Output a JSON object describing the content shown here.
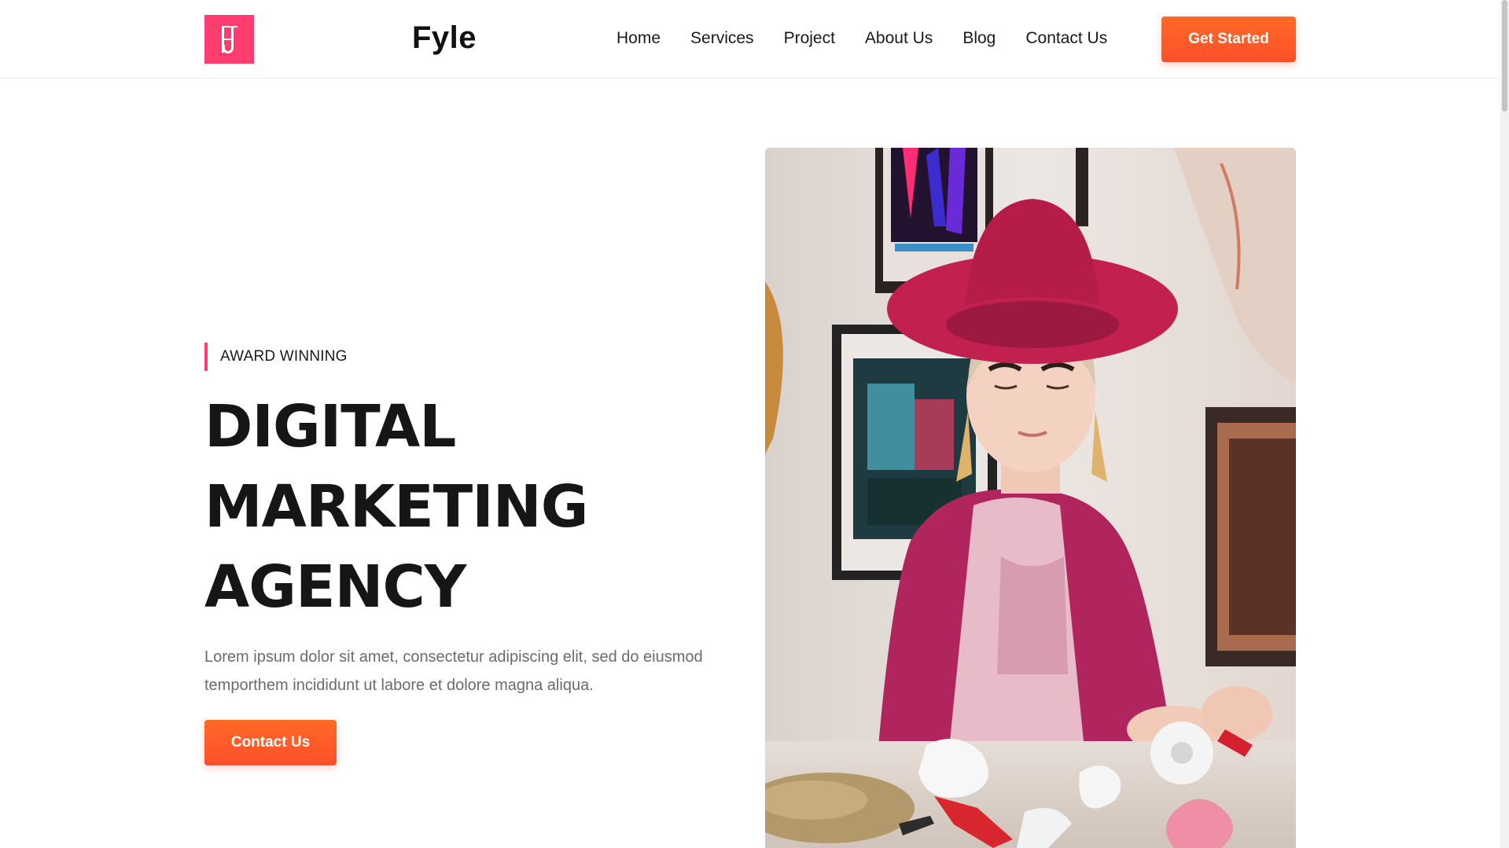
{
  "header": {
    "brand": "Fyle",
    "nav": [
      "Home",
      "Services",
      "Project",
      "About Us",
      "Blog",
      "Contact Us"
    ],
    "cta": "Get Started"
  },
  "hero": {
    "eyebrow": "AWARD WINNING",
    "headline": [
      "DIGITAL",
      "MARKETING",
      "AGENCY"
    ],
    "description": "Lorem ipsum dolor sit amet, consectetur adipiscing elit, sed do eiusmod temporthem incididunt ut labore et dolore magna aliqua.",
    "button": "Contact Us"
  },
  "colors": {
    "accent_pink": "#ff3d6e",
    "accent_orange": "#fd5a28"
  },
  "icons": {
    "logo": "brand-logo-icon"
  }
}
